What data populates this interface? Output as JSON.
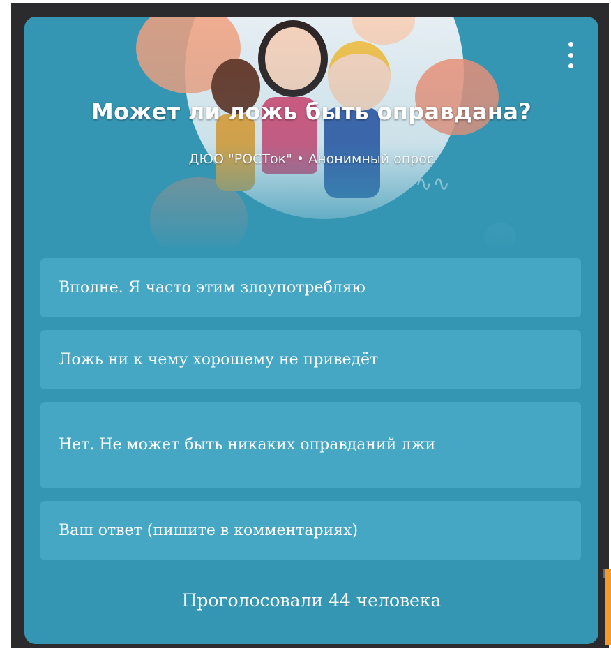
{
  "poll": {
    "title": "Может ли ложь быть оправдана?",
    "subtitle": "ДЮО \"РОСТок\" • Анонимный опрос",
    "options": [
      "Вполне. Я часто этим злоупотребляю",
      "Ложь ни к чему хорошему не приведёт",
      "Нет. Не может быть никаких оправданий лжи",
      "Ваш ответ (пишите в комментариях)"
    ],
    "votes": "Проголосовали 44 человека"
  },
  "icons": {
    "menu": "more-vertical-icon",
    "illustration": "children-illustration"
  },
  "colors": {
    "card": "#3596b3",
    "option": "#45a7c3",
    "text": "#ffffff"
  }
}
